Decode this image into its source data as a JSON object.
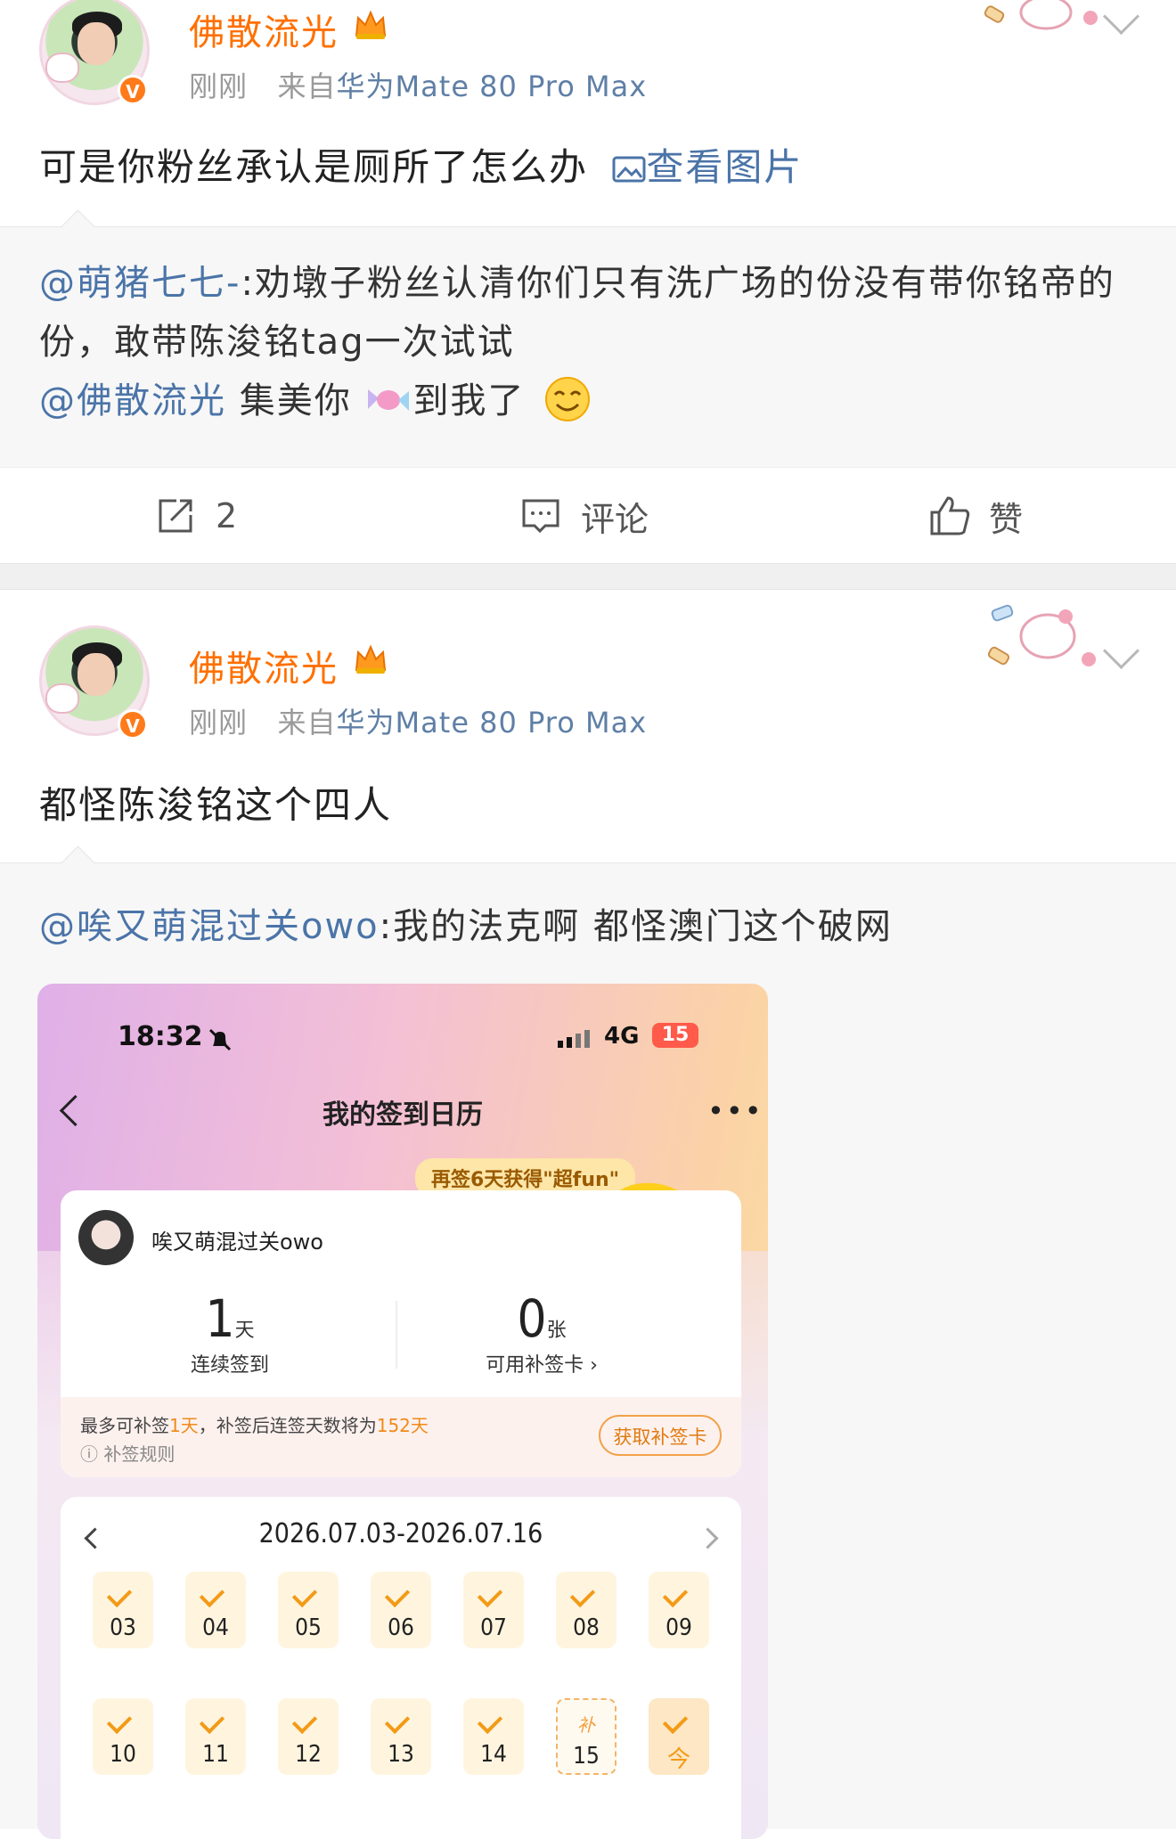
{
  "posts": [
    {
      "username": "佛散流光",
      "time": "刚刚",
      "source_prefix": "来自",
      "source": "华为Mate 80 Pro Max",
      "text": "可是你粉丝承认是厕所了怎么办",
      "image_link": "查看图片",
      "quote": {
        "mention": "@萌猪七七-",
        "text": ":劝墩子粉丝认清你们只有洗广场的份没有带你铭帝的份，敢带陈浚铭tag一次试试",
        "reply_mention": "@佛散流光",
        "reply_text_a": " 集美你",
        "reply_text_b": "到我了"
      },
      "actions": {
        "share_count": "2",
        "comment_label": "评论",
        "like_label": "赞"
      }
    },
    {
      "username": "佛散流光",
      "time": "刚刚",
      "source_prefix": "来自",
      "source": "华为Mate 80 Pro Max",
      "text": "都怪陈浚铭这个四人",
      "quote": {
        "mention": "@唉又萌混过关owo",
        "text": ":我的法克啊 都怪澳门这个破网"
      }
    }
  ],
  "embedded": {
    "status_time": "18:32",
    "network": "4G",
    "battery": "15",
    "title": "我的签到日历",
    "promo": "再签6天获得\"超fun\"",
    "user": "唉又萌混过关owo",
    "streak_num": "1",
    "streak_unit": "天",
    "streak_label": "连续签到",
    "cards_num": "0",
    "cards_unit": "张",
    "cards_label": "可用补签卡",
    "note_a": "最多可补签",
    "note_b": "1天",
    "note_c": "，补签后连签天数将为",
    "note_d": "152天",
    "rules": "补签规则",
    "get_card": "获取补签卡",
    "range": "2026.07.03-2026.07.16",
    "row1": [
      "03",
      "04",
      "05",
      "06",
      "07",
      "08",
      "09"
    ],
    "row2": [
      "10",
      "11",
      "12",
      "13",
      "14"
    ],
    "makeup_mark": "补",
    "makeup_day": "15",
    "today": "今"
  },
  "colors": {
    "accent": "#ff7000",
    "link": "#4b74a8",
    "check": "#f39a16"
  }
}
